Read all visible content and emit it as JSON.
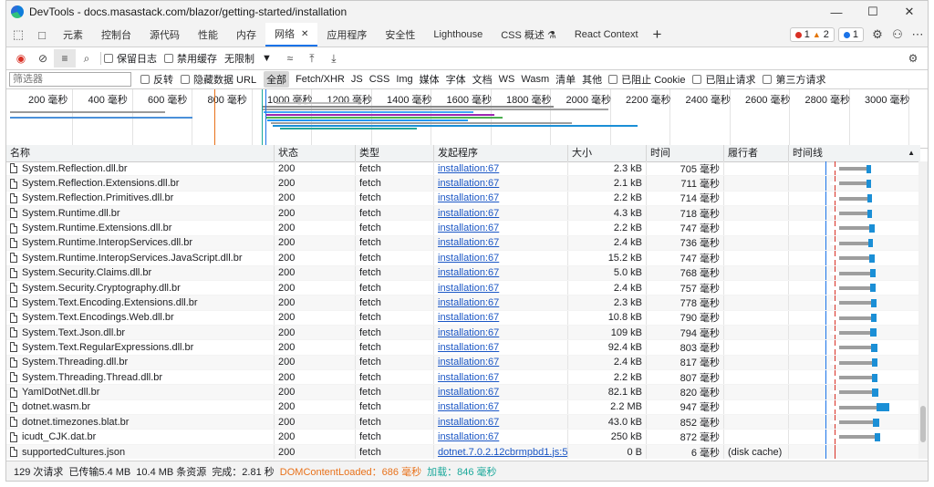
{
  "window": {
    "title": "DevTools - docs.masastack.com/blazor/getting-started/installation",
    "buttons": [
      "—",
      "☐",
      "✕"
    ]
  },
  "tabs": [
    {
      "label": "元素"
    },
    {
      "label": "控制台"
    },
    {
      "label": "源代码"
    },
    {
      "label": "性能"
    },
    {
      "label": "内存"
    },
    {
      "label": "网络",
      "active": true
    },
    {
      "label": "应用程序"
    },
    {
      "label": "安全性"
    },
    {
      "label": "Lighthouse"
    },
    {
      "label": "CSS 概述 ⚗"
    },
    {
      "label": "React Context"
    }
  ],
  "badges": {
    "errors": "1",
    "warnings": "2",
    "info": "1"
  },
  "toolbar": {
    "preserve_log": "保留日志",
    "disable_cache": "禁用缓存",
    "throttling": "无限制"
  },
  "filter": {
    "placeholder": "筛选器",
    "invert": "反转",
    "hide_data_urls": "隐藏数据 URL",
    "types": [
      "全部",
      "Fetch/XHR",
      "JS",
      "CSS",
      "Img",
      "媒体",
      "字体",
      "文档",
      "WS",
      "Wasm",
      "清单",
      "其他"
    ],
    "blocked_cookies": "已阻止 Cookie",
    "blocked_requests": "已阻止请求",
    "third_party": "第三方请求"
  },
  "overview": {
    "ticks": [
      "200 毫秒",
      "400 毫秒",
      "600 毫秒",
      "800 毫秒",
      "1000 毫秒",
      "1200 毫秒",
      "1400 毫秒",
      "1600 毫秒",
      "1800 毫秒",
      "2000 毫秒",
      "2200 毫秒",
      "2400 毫秒",
      "2600 毫秒",
      "2800 毫秒",
      "3000 毫秒"
    ]
  },
  "columns": {
    "name": "名称",
    "status": "状态",
    "type": "类型",
    "initiator": "发起程序",
    "size": "大小",
    "time": "时间",
    "fulfilled_by": "履行者",
    "waterfall": "时间线"
  },
  "rows": [
    {
      "name": "System.Reflection.dll.br",
      "status": "200",
      "type": "fetch",
      "initiator": "installation:67",
      "size": "2.3 kB",
      "time": "705 毫秒",
      "fulfilled": "",
      "start": 0.1,
      "wait": 0.3,
      "recv": 0.05
    },
    {
      "name": "System.Reflection.Extensions.dll.br",
      "status": "200",
      "type": "fetch",
      "initiator": "installation:67",
      "size": "2.1 kB",
      "time": "711 毫秒",
      "fulfilled": "",
      "start": 0.1,
      "wait": 0.3,
      "recv": 0.05
    },
    {
      "name": "System.Reflection.Primitives.dll.br",
      "status": "200",
      "type": "fetch",
      "initiator": "installation:67",
      "size": "2.2 kB",
      "time": "714 毫秒",
      "fulfilled": "",
      "start": 0.1,
      "wait": 0.31,
      "recv": 0.05
    },
    {
      "name": "System.Runtime.dll.br",
      "status": "200",
      "type": "fetch",
      "initiator": "installation:67",
      "size": "4.3 kB",
      "time": "718 毫秒",
      "fulfilled": "",
      "start": 0.1,
      "wait": 0.31,
      "recv": 0.05
    },
    {
      "name": "System.Runtime.Extensions.dll.br",
      "status": "200",
      "type": "fetch",
      "initiator": "installation:67",
      "size": "2.2 kB",
      "time": "747 毫秒",
      "fulfilled": "",
      "start": 0.1,
      "wait": 0.33,
      "recv": 0.05
    },
    {
      "name": "System.Runtime.InteropServices.dll.br",
      "status": "200",
      "type": "fetch",
      "initiator": "installation:67",
      "size": "2.4 kB",
      "time": "736 毫秒",
      "fulfilled": "",
      "start": 0.1,
      "wait": 0.32,
      "recv": 0.05
    },
    {
      "name": "System.Runtime.InteropServices.JavaScript.dll.br",
      "status": "200",
      "type": "fetch",
      "initiator": "installation:67",
      "size": "15.2 kB",
      "time": "747 毫秒",
      "fulfilled": "",
      "start": 0.1,
      "wait": 0.33,
      "recv": 0.05
    },
    {
      "name": "System.Security.Claims.dll.br",
      "status": "200",
      "type": "fetch",
      "initiator": "installation:67",
      "size": "5.0 kB",
      "time": "768 毫秒",
      "fulfilled": "",
      "start": 0.1,
      "wait": 0.34,
      "recv": 0.05
    },
    {
      "name": "System.Security.Cryptography.dll.br",
      "status": "200",
      "type": "fetch",
      "initiator": "installation:67",
      "size": "2.4 kB",
      "time": "757 毫秒",
      "fulfilled": "",
      "start": 0.1,
      "wait": 0.34,
      "recv": 0.05
    },
    {
      "name": "System.Text.Encoding.Extensions.dll.br",
      "status": "200",
      "type": "fetch",
      "initiator": "installation:67",
      "size": "2.3 kB",
      "time": "778 毫秒",
      "fulfilled": "",
      "start": 0.1,
      "wait": 0.35,
      "recv": 0.05
    },
    {
      "name": "System.Text.Encodings.Web.dll.br",
      "status": "200",
      "type": "fetch",
      "initiator": "installation:67",
      "size": "10.8 kB",
      "time": "790 毫秒",
      "fulfilled": "",
      "start": 0.1,
      "wait": 0.35,
      "recv": 0.05
    },
    {
      "name": "System.Text.Json.dll.br",
      "status": "200",
      "type": "fetch",
      "initiator": "installation:67",
      "size": "109 kB",
      "time": "794 毫秒",
      "fulfilled": "",
      "start": 0.1,
      "wait": 0.34,
      "recv": 0.06
    },
    {
      "name": "System.Text.RegularExpressions.dll.br",
      "status": "200",
      "type": "fetch",
      "initiator": "installation:67",
      "size": "92.4 kB",
      "time": "803 毫秒",
      "fulfilled": "",
      "start": 0.1,
      "wait": 0.35,
      "recv": 0.06
    },
    {
      "name": "System.Threading.dll.br",
      "status": "200",
      "type": "fetch",
      "initiator": "installation:67",
      "size": "2.4 kB",
      "time": "817 毫秒",
      "fulfilled": "",
      "start": 0.1,
      "wait": 0.36,
      "recv": 0.05
    },
    {
      "name": "System.Threading.Thread.dll.br",
      "status": "200",
      "type": "fetch",
      "initiator": "installation:67",
      "size": "2.2 kB",
      "time": "807 毫秒",
      "fulfilled": "",
      "start": 0.1,
      "wait": 0.36,
      "recv": 0.05
    },
    {
      "name": "YamlDotNet.dll.br",
      "status": "200",
      "type": "fetch",
      "initiator": "installation:67",
      "size": "82.1 kB",
      "time": "820 毫秒",
      "fulfilled": "",
      "start": 0.1,
      "wait": 0.36,
      "recv": 0.06
    },
    {
      "name": "dotnet.wasm.br",
      "status": "200",
      "type": "fetch",
      "initiator": "installation:67",
      "size": "2.2 MB",
      "time": "947 毫秒",
      "fulfilled": "",
      "start": 0.1,
      "wait": 0.4,
      "recv": 0.14
    },
    {
      "name": "dotnet.timezones.blat.br",
      "status": "200",
      "type": "fetch",
      "initiator": "installation:67",
      "size": "43.0 kB",
      "time": "852 毫秒",
      "fulfilled": "",
      "start": 0.1,
      "wait": 0.37,
      "recv": 0.06
    },
    {
      "name": "icudt_CJK.dat.br",
      "status": "200",
      "type": "fetch",
      "initiator": "installation:67",
      "size": "250 kB",
      "time": "872 毫秒",
      "fulfilled": "",
      "start": 0.1,
      "wait": 0.38,
      "recv": 0.06
    },
    {
      "name": "supportedCultures.json",
      "status": "200",
      "type": "fetch",
      "initiator": "dotnet.7.0.2.12cbrmpbd1.js:5",
      "size": "0 B",
      "time": "6 毫秒",
      "fulfilled": "(disk cache)",
      "start": 0.0,
      "wait": 0.0,
      "recv": 0.0
    }
  ],
  "status": {
    "requests": "129 次请求",
    "transferred": "已传输5.4 MB",
    "resources": "10.4 MB 条资源",
    "finish": "完成：2.81 秒",
    "dcl": "DOMContentLoaded：686 毫秒",
    "load": "加载：846 毫秒"
  },
  "colors": {
    "accent": "#1a73e8",
    "dcl": "#e8711a",
    "load": "#1aa89a",
    "link": "#1a56c5",
    "bar": "#1b8fd6"
  }
}
